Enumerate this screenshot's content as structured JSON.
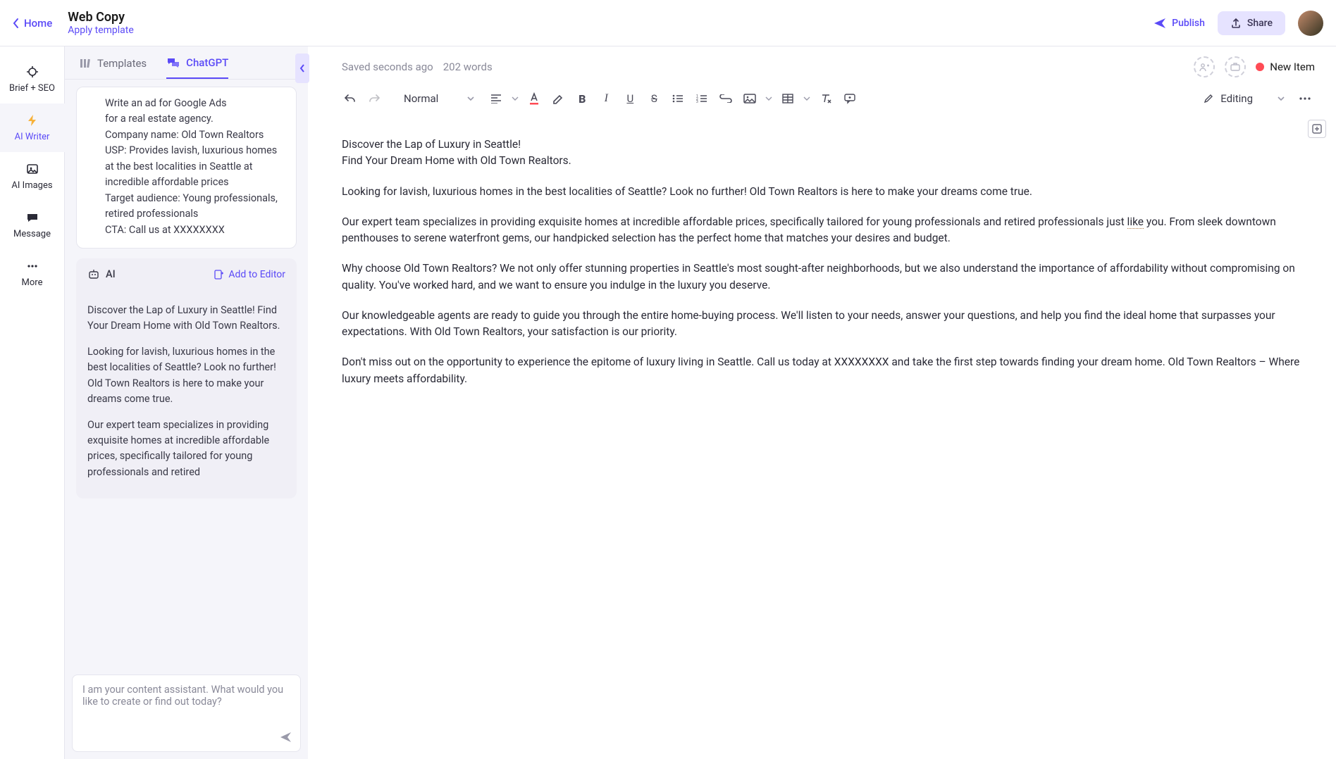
{
  "header": {
    "home": "Home",
    "title": "Web Copy",
    "apply": "Apply template",
    "publish": "Publish",
    "share": "Share"
  },
  "rail": {
    "brief": "Brief + SEO",
    "writer": "AI Writer",
    "images": "AI Images",
    "message": "Message",
    "more": "More"
  },
  "panel": {
    "tab_templates": "Templates",
    "tab_chat": "ChatGPT",
    "user_prompt": "Write an ad for Google Ads\nfor a real estate agency.\nCompany name: Old Town Realtors\nUSP: Provides lavish, luxurious homes at the best localities in Seattle at incredible affordable prices\nTarget audience: Young professionals, retired professionals\nCTA: Call us at XXXXXXXX",
    "ai_label": "AI",
    "add_editor": "Add to Editor",
    "ai_p1": "Discover the Lap of Luxury in Seattle! Find Your Dream Home with Old Town Realtors.",
    "ai_p2": "Looking for lavish, luxurious homes in the best localities of Seattle? Look no further! Old Town Realtors is here to make your dreams come true.",
    "ai_p3": "Our expert team specializes in providing exquisite homes at incredible affordable prices, specifically tailored for young professionals and retired",
    "input_ph": "I am your content assistant. What would you like to create or find out today?"
  },
  "editor": {
    "saved": "Saved seconds ago",
    "words": "202 words",
    "new_item": "New Item",
    "format": "Normal",
    "mode": "Editing"
  },
  "document": {
    "p1a": "Discover the Lap of Luxury in Seattle!",
    "p1b": "Find Your Dream Home with Old Town Realtors.",
    "p2": "Looking for lavish, luxurious homes in the best localities of Seattle? Look no further! Old Town Realtors is here to make your dreams come true.",
    "p3a": "Our expert team specializes in providing exquisite homes at incredible affordable prices, specifically tailored for young professionals and retired professionals just ",
    "p3w": "like",
    "p3b": " you. From sleek downtown penthouses to serene waterfront gems, our handpicked selection has the perfect home that matches your desires and budget.",
    "p4": "Why choose Old Town Realtors? We not only offer stunning properties in Seattle's most sought-after neighborhoods, but we also understand the importance of affordability without compromising on quality. You've worked hard, and we want to ensure you indulge in the luxury you deserve.",
    "p5": "Our knowledgeable agents are ready to guide you through the entire home-buying process. We'll listen to your needs, answer your questions, and help you find the ideal home that surpasses your expectations. With Old Town Realtors, your satisfaction is our priority.",
    "p6": "Don't miss out on the opportunity to experience the epitome of luxury living in Seattle. Call us today at XXXXXXXX and take the first step towards finding your dream home. Old Town Realtors – Where luxury meets affordability."
  }
}
